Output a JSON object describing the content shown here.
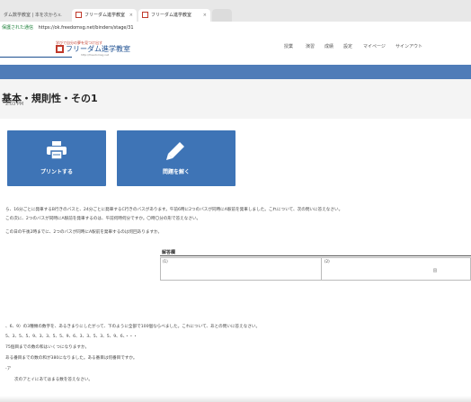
{
  "browser": {
    "tabs": [
      {
        "label": "ダム数学教室 | 本を次から…"
      },
      {
        "label": "フリーダム進学教室"
      },
      {
        "label": "フリーダム進学教室"
      }
    ],
    "tab_close": "×",
    "security_label": "保護された通信",
    "url": "https://ok.freedomsg.net/binders/stage/31"
  },
  "header": {
    "logo_tagline": "学びで自分の夢を見つけ出す",
    "logo_name": "フリーダム進学教室",
    "logo_url": "http://freedomsg.net",
    "nav": [
      "授業",
      "演習",
      "成績",
      "設定",
      "マイページ",
      "サインアウト"
    ]
  },
  "page": {
    "title": "基本・規則性・その1",
    "time": "2:03 PM"
  },
  "buttons": {
    "print": "プリントする",
    "solve": "問題を解く"
  },
  "problem1": {
    "line1": "ら、16分ごとに発車するB行きのバスと、24分ごとに発車するC行きのバスがあります。午前6時に2つのバスが同時にA駅前を発車しました。これについて、次の問いに答えなさい。",
    "line2": "この次に、2つのバスが同時にA駅前を発車するのは、午前何時何分ですか。〇時〇分の形で答えなさい。",
    "line3": "この日の午後2時までに、2つのバスが同時にA駅前を発車するのは何回ありますか。"
  },
  "answer": {
    "title": "解答欄",
    "label1": "(1)",
    "label2": "(2)",
    "unit": "回"
  },
  "problem2": {
    "line1": "、6、9）の3種類の数字を、あるきまりにしたがって、下のように全部で100個ならべました。これについて、あとの問いに答えなさい。",
    "line2": "5、3、5、5、9、3、3、5、5、9、6、3、3、5、3、5、9、6、・・・",
    "line3": "75個目までの数の和はいくつになりますか。",
    "line4": "ある番目までの数の和が380になりました。ある番目は何番目ですか。",
    "line5": "-ア",
    "line6": "次のアとイにあてはまる数を答えなさい。"
  }
}
